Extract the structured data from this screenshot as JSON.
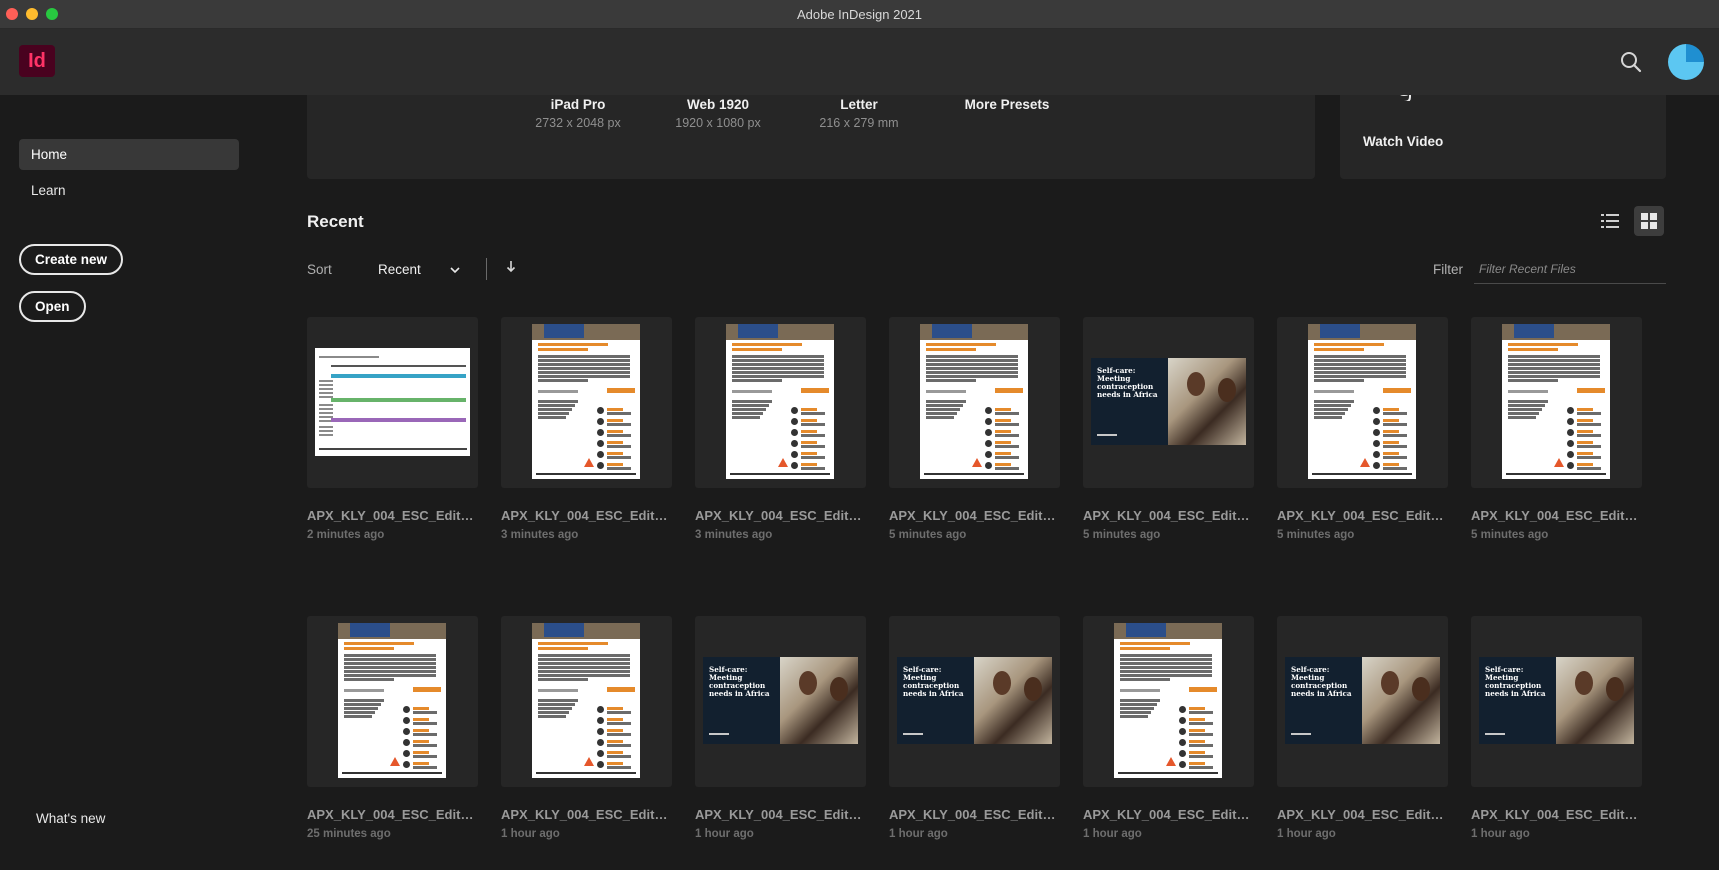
{
  "window": {
    "title": "Adobe InDesign 2021"
  },
  "app": {
    "logo_text": "Id"
  },
  "sidebar": {
    "items": [
      {
        "label": "Home",
        "active": true
      },
      {
        "label": "Learn",
        "active": false
      }
    ],
    "create_new_label": "Create new",
    "open_label": "Open",
    "whats_new_label": "What's new"
  },
  "presets": [
    {
      "name": "iPad Pro",
      "size": "2732 x 2048 px"
    },
    {
      "name": "Web 1920",
      "size": "1920 x 1080 px"
    },
    {
      "name": "Letter",
      "size": "216 x 279 mm"
    },
    {
      "name": "More Presets",
      "size": ""
    }
  ],
  "video_panel": {
    "watch_video_label": "Watch Video"
  },
  "recent": {
    "title": "Recent",
    "sort_label": "Sort",
    "sort_value": "Recent",
    "filter_label": "Filter",
    "filter_placeholder": "Filter Recent Files",
    "view_mode": "grid"
  },
  "files": [
    {
      "thumb": "table",
      "name": "APX_KLY_004_ESC_Edited...",
      "time": "2 minutes ago"
    },
    {
      "thumb": "doc",
      "name": "APX_KLY_004_ESC_Edited...",
      "time": "3 minutes ago"
    },
    {
      "thumb": "doc",
      "name": "APX_KLY_004_ESC_Edited...",
      "time": "3 minutes ago"
    },
    {
      "thumb": "doc",
      "name": "APX_KLY_004_ESC_Edited...",
      "time": "5 minutes ago"
    },
    {
      "thumb": "slide",
      "name": "APX_KLY_004_ESC_Edited...",
      "time": "5 minutes ago"
    },
    {
      "thumb": "doc",
      "name": "APX_KLY_004_ESC_Edited...",
      "time": "5 minutes ago"
    },
    {
      "thumb": "doc",
      "name": "APX_KLY_004_ESC_Edited...",
      "time": "5 minutes ago"
    },
    {
      "thumb": "doc",
      "name": "APX_KLY_004_ESC_Edited...",
      "time": "25 minutes ago"
    },
    {
      "thumb": "doc",
      "name": "APX_KLY_004_ESC_Edited...",
      "time": "1 hour ago"
    },
    {
      "thumb": "slide",
      "name": "APX_KLY_004_ESC_Edited...",
      "time": "1 hour ago"
    },
    {
      "thumb": "slide",
      "name": "APX_KLY_004_ESC_Edited...",
      "time": "1 hour ago"
    },
    {
      "thumb": "doc",
      "name": "APX_KLY_004_ESC_Edited...",
      "time": "1 hour ago"
    },
    {
      "thumb": "slide",
      "name": "APX_KLY_004_ESC_Edited...",
      "time": "1 hour ago"
    },
    {
      "thumb": "slide",
      "name": "APX_KLY_004_ESC_Edited...",
      "time": "1 hour ago"
    }
  ],
  "slide_thumb_text": "Self-care: Meeting contraception needs in Africa",
  "colors": {
    "accent": "#ff3366",
    "logo_bg": "#49021f",
    "background": "#1b1b1b",
    "panel": "#262626"
  }
}
